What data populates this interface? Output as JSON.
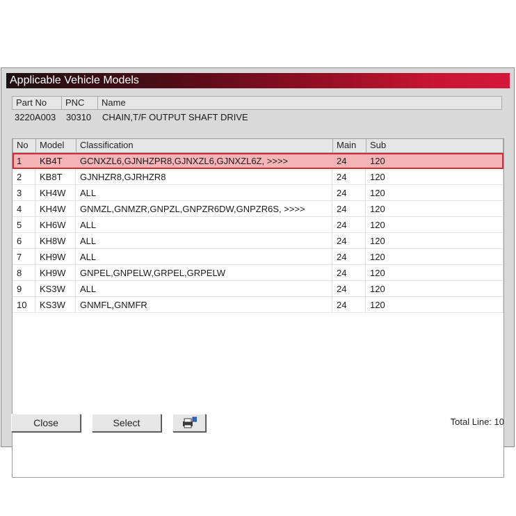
{
  "window": {
    "title": "Applicable Vehicle Models"
  },
  "part_table": {
    "headers": [
      "Part No",
      "PNC",
      "Name"
    ],
    "row": {
      "part_no": "3220A003",
      "pnc": "30310",
      "name": "CHAIN,T/F OUTPUT SHAFT DRIVE"
    }
  },
  "models_table": {
    "headers": [
      "No",
      "Model",
      "Classification",
      "Main",
      "Sub"
    ],
    "selected_index": 0,
    "rows": [
      {
        "no": "1",
        "model": "KB4T",
        "classification": "GCNXZL6,GJNHZPR8,GJNXZL6,GJNXZL6Z,  >>>>",
        "main": "24",
        "sub": "120"
      },
      {
        "no": "2",
        "model": "KB8T",
        "classification": "GJNHZR8,GJRHZR8",
        "main": "24",
        "sub": "120"
      },
      {
        "no": "3",
        "model": "KH4W",
        "classification": "ALL",
        "main": "24",
        "sub": "120"
      },
      {
        "no": "4",
        "model": "KH4W",
        "classification": "GNMZL,GNMZR,GNPZL,GNPZR6DW,GNPZR6S,  >>>>",
        "main": "24",
        "sub": "120"
      },
      {
        "no": "5",
        "model": "KH6W",
        "classification": "ALL",
        "main": "24",
        "sub": "120"
      },
      {
        "no": "6",
        "model": "KH8W",
        "classification": "ALL",
        "main": "24",
        "sub": "120"
      },
      {
        "no": "7",
        "model": "KH9W",
        "classification": "ALL",
        "main": "24",
        "sub": "120"
      },
      {
        "no": "8",
        "model": "KH9W",
        "classification": "GNPEL,GNPELW,GRPEL,GRPELW",
        "main": "24",
        "sub": "120"
      },
      {
        "no": "9",
        "model": "KS3W",
        "classification": "ALL",
        "main": "24",
        "sub": "120"
      },
      {
        "no": "10",
        "model": "KS3W",
        "classification": "GNMFL,GNMFR",
        "main": "24",
        "sub": "120"
      }
    ]
  },
  "buttons": {
    "close": "Close",
    "select": "Select",
    "print_icon": "printer-icon"
  },
  "status": {
    "total_line": "Total Line: 10"
  },
  "colors": {
    "title_gradient_start": "#1e1012",
    "title_gradient_end": "#d4173a",
    "selected_row": "#f4b4b6",
    "selected_border": "#d22a35"
  }
}
